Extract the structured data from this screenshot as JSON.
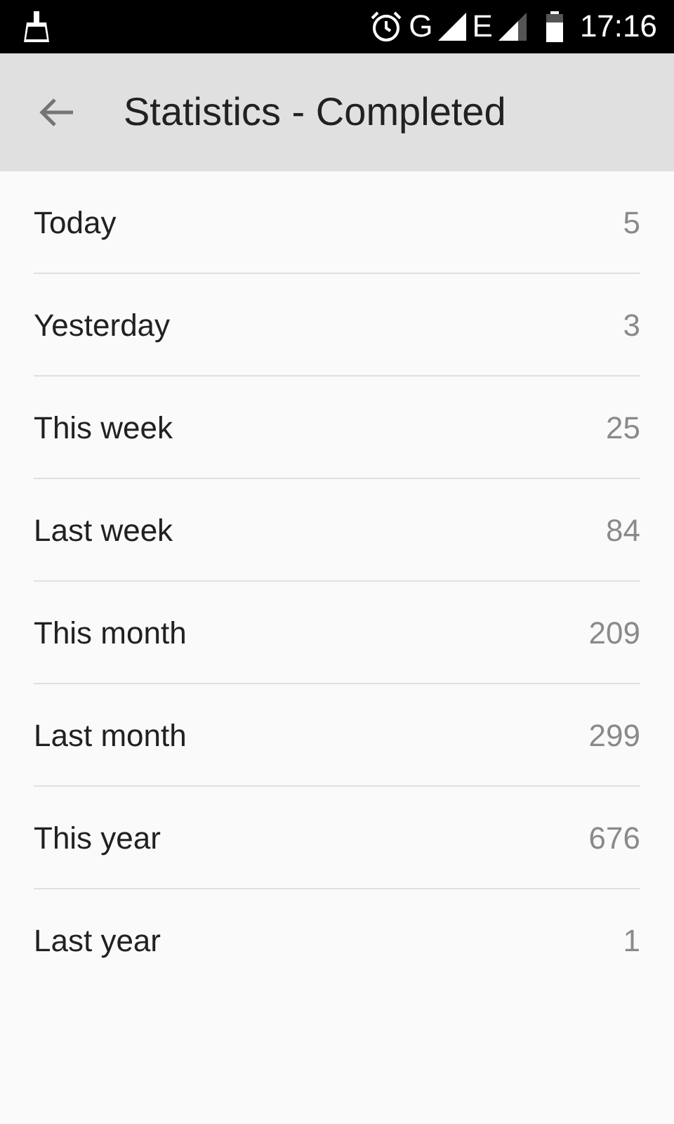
{
  "status_bar": {
    "network_1": "G",
    "network_2": "E",
    "time": "17:16"
  },
  "app_bar": {
    "title": "Statistics - Completed"
  },
  "stats": [
    {
      "label": "Today",
      "value": "5"
    },
    {
      "label": "Yesterday",
      "value": "3"
    },
    {
      "label": "This week",
      "value": "25"
    },
    {
      "label": "Last week",
      "value": "84"
    },
    {
      "label": "This month",
      "value": "209"
    },
    {
      "label": "Last month",
      "value": "299"
    },
    {
      "label": "This year",
      "value": "676"
    },
    {
      "label": "Last year",
      "value": "1"
    }
  ]
}
